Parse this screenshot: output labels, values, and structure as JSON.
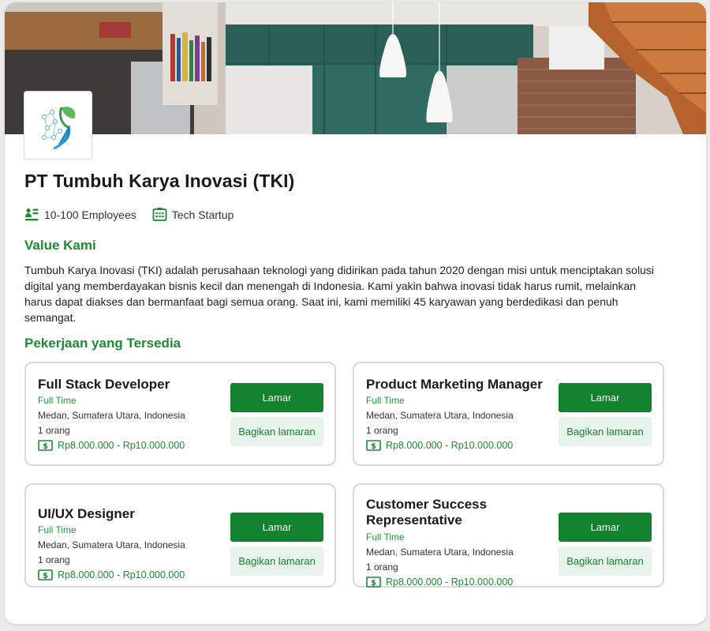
{
  "company": {
    "name": "PT Tumbuh Karya Inovasi (TKI)",
    "employees": "10-100 Employees",
    "industry": "Tech Startup",
    "icons": [
      "employees-icon",
      "building-icon"
    ]
  },
  "value_section": {
    "title": "Value Kami",
    "body": "Tumbuh Karya Inovasi (TKI) adalah perusahaan teknologi yang didirikan pada tahun 2020 dengan misi untuk menciptakan solusi digital yang memberdayakan bisnis kecil dan menengah di Indonesia. Kami yakin bahwa inovasi tidak harus rumit, melainkan harus dapat diakses dan bermanfaat bagi semua orang. Saat ini, kami memiliki 45 karyawan yang berdedikasi dan penuh semangat."
  },
  "jobs_section": {
    "title": "Pekerjaan yang Tersedia",
    "jobs": [
      {
        "title": "Full Stack Developer",
        "type": "Full Time",
        "location": "Medan, Sumatera Utara, Indonesia",
        "openings": "1 orang",
        "salary": "Rp8.000.000 - Rp10.000.000",
        "apply_label": "Lamar",
        "share_label": "Bagikan lamaran"
      },
      {
        "title": "Product Marketing Manager",
        "type": "Full Time",
        "location": "Medan, Sumatera Utara, Indonesia",
        "openings": "1 orang",
        "salary": "Rp8.000.000 - Rp10.000.000",
        "apply_label": "Lamar",
        "share_label": "Bagikan lamaran"
      },
      {
        "title": "UI/UX Designer",
        "type": "Full Time",
        "location": "Medan, Sumatera Utara, Indonesia",
        "openings": "1 orang",
        "salary": "Rp8.000.000 - Rp10.000.000",
        "apply_label": "Lamar",
        "share_label": "Bagikan lamaran"
      },
      {
        "title": "Customer Success Representative",
        "type": "Full Time",
        "location": "Medan, Sumatera Utara, Indonesia",
        "openings": "1 orang",
        "salary": "Rp8.000.000 - Rp10.000.000",
        "apply_label": "Lamar",
        "share_label": "Bagikan lamaran"
      }
    ]
  },
  "colors": {
    "accent_green": "#1f8a36",
    "button_green": "#13822f",
    "share_bg": "#e8f4eb"
  }
}
